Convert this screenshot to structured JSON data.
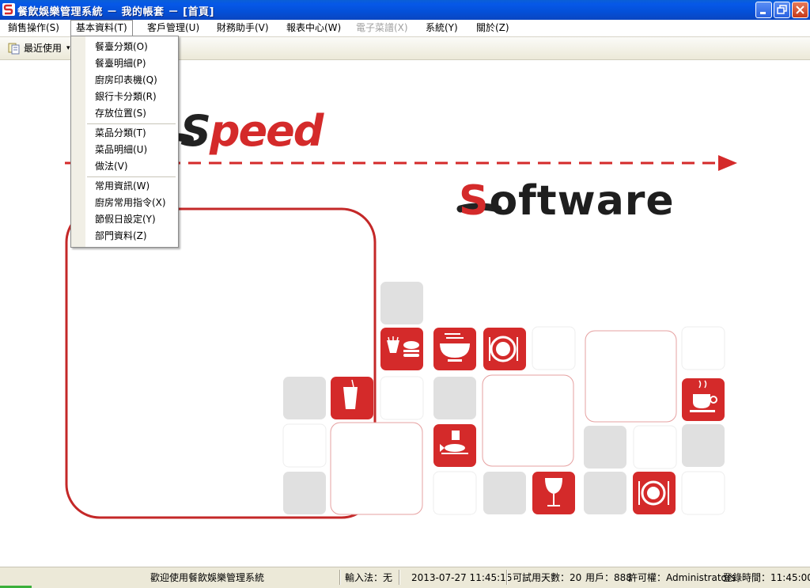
{
  "window": {
    "title": "餐飲娛樂管理系統 － 我的帳套 － [首頁]"
  },
  "menu": {
    "items": [
      {
        "label": "銷售操作(S)"
      },
      {
        "label": "基本資料(T)"
      },
      {
        "label": "客戶管理(U)"
      },
      {
        "label": "財務助手(V)"
      },
      {
        "label": "報表中心(W)"
      },
      {
        "label": "電子菜譜(X)"
      },
      {
        "label": "系統(Y)"
      },
      {
        "label": "關於(Z)"
      }
    ]
  },
  "toolbar": {
    "recent_label": "最近使用"
  },
  "dropdown": {
    "items": [
      {
        "label": "餐臺分類(O)"
      },
      {
        "label": "餐臺明細(P)"
      },
      {
        "label": "廚房印表機(Q)"
      },
      {
        "label": "銀行卡分類(R)"
      },
      {
        "label": "存放位置(S)"
      },
      {
        "label": "菜品分類(T)"
      },
      {
        "label": "菜品明細(U)"
      },
      {
        "label": "做法(V)"
      },
      {
        "label": "常用資訊(W)"
      },
      {
        "label": "廚房常用指令(X)"
      },
      {
        "label": "節假日設定(Y)"
      },
      {
        "label": "部門資料(Z)"
      }
    ]
  },
  "splash": {
    "brand_text_1_s": "S",
    "brand_text_1_rest": "peed",
    "brand_text_2_s": "S",
    "brand_text_2_rest": "oftware",
    "accent_color": "#d42a2a"
  },
  "statusbar": {
    "welcome": "歡迎使用餐飲娛樂管理系統",
    "ime": "輸入法：无",
    "datetime": "2013-07-27 11:45:15",
    "trial_days": "可試用天數：20",
    "user": "用戶：888",
    "permission": "許可權：Administrators",
    "login_time": "登錄時間：11:45:00"
  }
}
